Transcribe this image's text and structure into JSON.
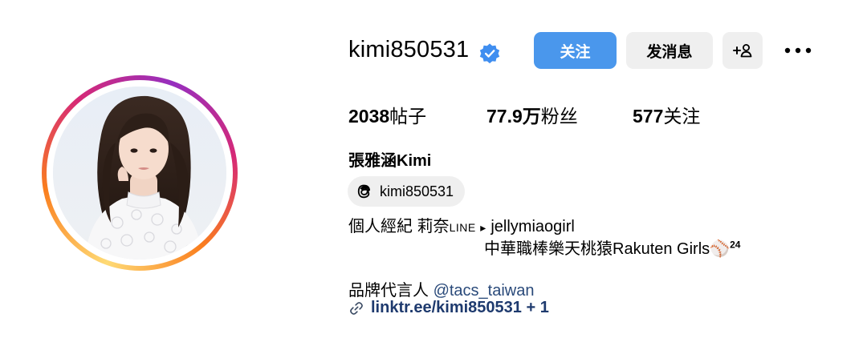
{
  "profile": {
    "username": "kimi850531",
    "verified": true,
    "full_name": "張雅涵Kimi",
    "threads_handle": "kimi850531"
  },
  "actions": {
    "follow_label": "关注",
    "message_label": "发消息",
    "add_user_label": "+",
    "more_icon": "more-horizontal-icon"
  },
  "stats": {
    "posts_count": "2038",
    "posts_label": "帖子",
    "followers_count": "77.9万",
    "followers_label": "粉丝",
    "following_count": "577",
    "following_label": "关注"
  },
  "bio": {
    "line1_prefix": "個人經紀 莉奈",
    "line1_tag": "LINE",
    "line1_arrow": "▸",
    "line1_suffix": "jellymiaogirl",
    "line2_text": "中華職棒樂天桃猿Rakuten Girls",
    "line2_emoji": "⚾",
    "line2_number": "24",
    "line3_prefix": "品牌代言人",
    "line3_mention": "@tacs_taiwan"
  },
  "link": {
    "text": "linktr.ee/kimi850531 + 1"
  },
  "colors": {
    "follow_button": "#4a97ec",
    "secondary_button": "#efefef",
    "verified_badge": "#3f8ef0",
    "link_text": "#1e3a6e"
  }
}
